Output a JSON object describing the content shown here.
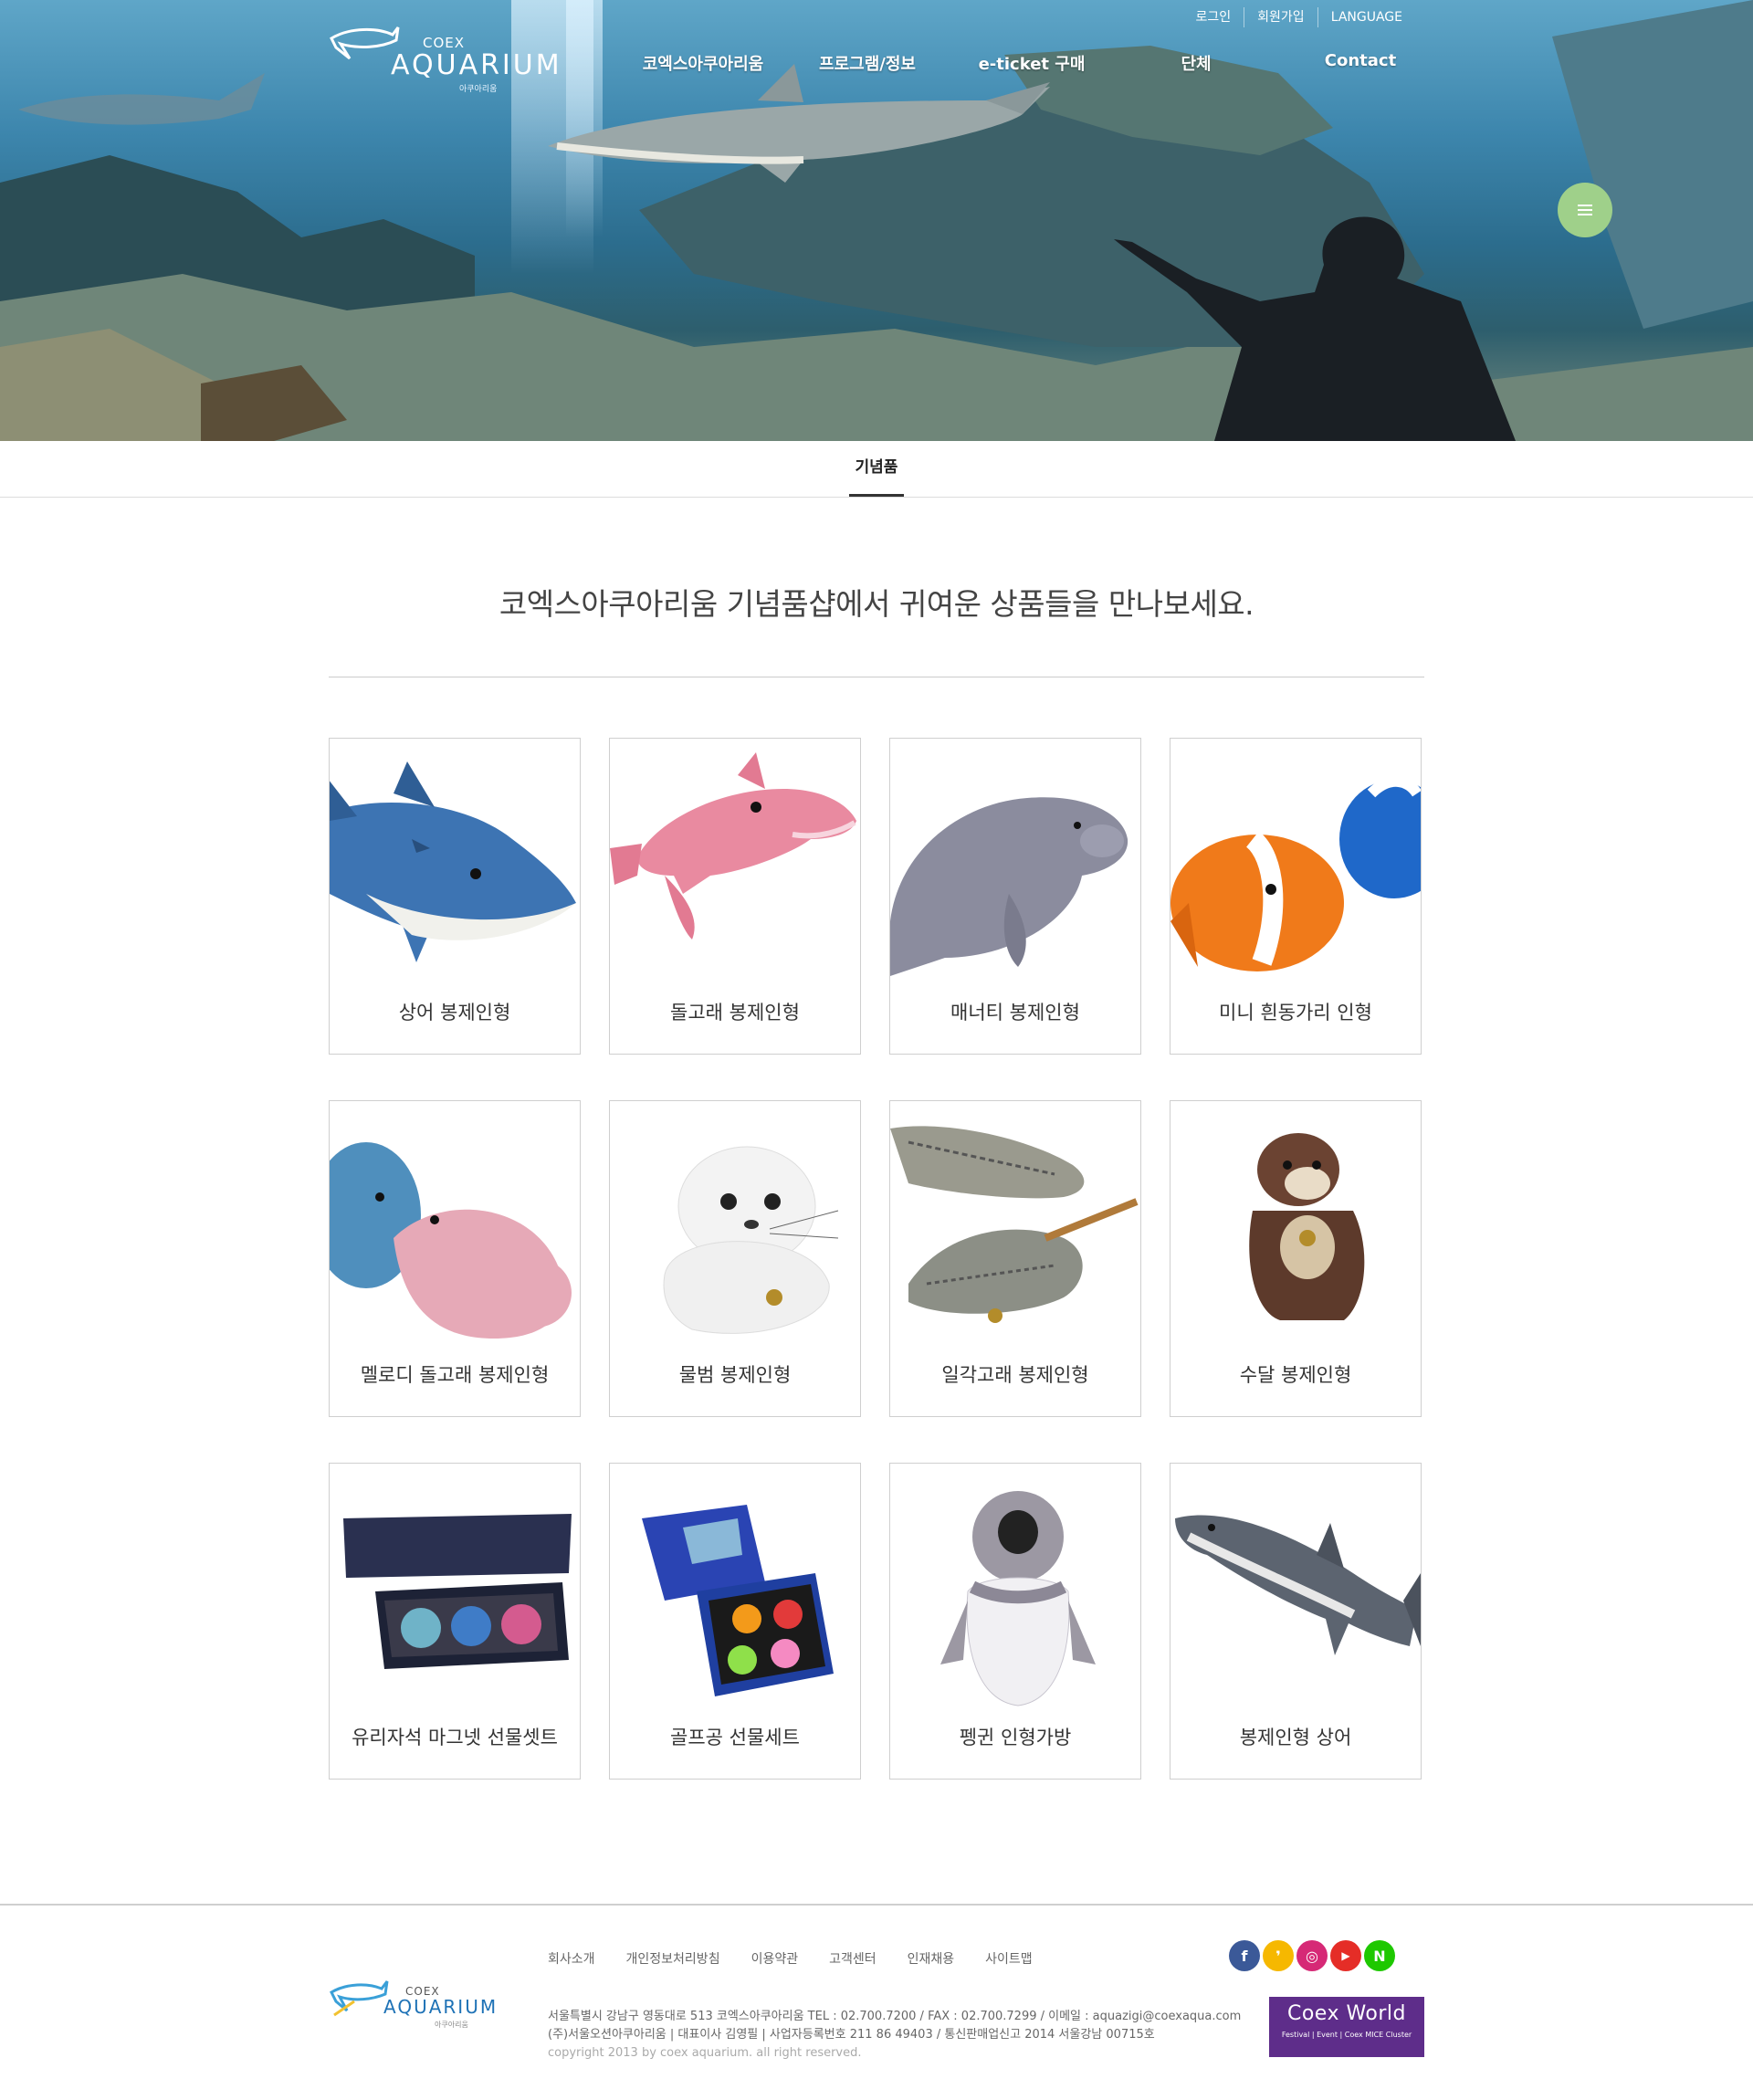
{
  "header": {
    "logo": {
      "brand_small": "COEX",
      "brand_main": "AQUARIUM",
      "brand_sub": "아쿠아리움"
    },
    "util_links": [
      "로그인",
      "회원가입",
      "LANGUAGE"
    ],
    "nav": [
      "코엑스아쿠아리움",
      "프로그램/정보",
      "e-ticket 구매",
      "단체",
      "Contact"
    ],
    "accent": "#9fd08a"
  },
  "tab": {
    "label": "기념품"
  },
  "intro": {
    "text": "코엑스아쿠아리움 기념품샵에서 귀여운 상품들을 만나보세요."
  },
  "products": [
    {
      "label": "상어 봉제인형",
      "icon": "shark-plush"
    },
    {
      "label": "돌고래 봉제인형",
      "icon": "dolphin-plush"
    },
    {
      "label": "매너티 봉제인형",
      "icon": "manatee-plush"
    },
    {
      "label": "미니 흰동가리 인형",
      "icon": "clownfish-plush"
    },
    {
      "label": "멜로디 돌고래 봉제인형",
      "icon": "melody-dolphin-plush"
    },
    {
      "label": "물범 봉제인형",
      "icon": "seal-plush"
    },
    {
      "label": "일각고래 봉제인형",
      "icon": "narwhal-plush"
    },
    {
      "label": "수달 봉제인형",
      "icon": "otter-plush"
    },
    {
      "label": "유리자석 마그넷 선물셋트",
      "icon": "magnet-set"
    },
    {
      "label": "골프공 선물세트",
      "icon": "golfball-set"
    },
    {
      "label": "펭귄 인형가방",
      "icon": "penguin-bag"
    },
    {
      "label": "봉제인형 상어",
      "icon": "shark-plush-grey"
    }
  ],
  "footer": {
    "links": [
      "회사소개",
      "개인정보처리방침",
      "이용약관",
      "고객센터",
      "인재채용",
      "사이트맵"
    ],
    "address": "서울특별시 강남구 영동대로 513 코엑스아쿠아리움 TEL : 02.700.7200 / FAX : 02.700.7299 / 이메일 : aquazigi@coexaqua.com",
    "company": "(주)서울오션아쿠아리움 | 대표이사 김영필 | 사업자등록번호 211 86 49403 / 통신판매업신고 2014 서울강남 00715호",
    "copyright": "copyright 2013 by coex aquarium. all right reserved.",
    "sns": [
      {
        "name": "facebook-icon",
        "glyph": "f",
        "color": "#3b5998"
      },
      {
        "name": "kakaostory-icon",
        "glyph": "❜",
        "color": "#f6b800"
      },
      {
        "name": "instagram-icon",
        "glyph": "◎",
        "color": "#d62976"
      },
      {
        "name": "youtube-icon",
        "glyph": "▶",
        "color": "#e52d27"
      },
      {
        "name": "naver-icon",
        "glyph": "N",
        "color": "#1ec800"
      }
    ],
    "coexworld": {
      "title": "Coex World",
      "sub": "Festival  |  Event  |  Coex MICE Cluster"
    }
  }
}
